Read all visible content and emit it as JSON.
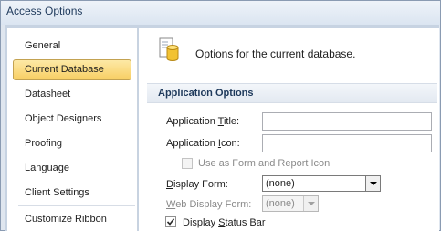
{
  "window": {
    "title": "Access Options"
  },
  "sidebar": {
    "items": [
      {
        "label": "General",
        "active": false
      },
      {
        "label": "Current Database",
        "active": true
      },
      {
        "label": "Datasheet",
        "active": false
      },
      {
        "label": "Object Designers",
        "active": false
      },
      {
        "label": "Proofing",
        "active": false
      },
      {
        "label": "Language",
        "active": false
      },
      {
        "label": "Client Settings",
        "active": false
      },
      {
        "label": "Customize Ribbon",
        "active": false
      }
    ]
  },
  "content": {
    "header": "Options for the current database.",
    "header_icon": "database-icon",
    "section_title": "Application Options",
    "app_title": {
      "label_pre": "Application ",
      "label_ul": "T",
      "label_post": "itle:",
      "value": ""
    },
    "app_icon": {
      "label_pre": "Application ",
      "label_ul": "I",
      "label_post": "con:",
      "value": ""
    },
    "form_report_icon": {
      "label": "Use as Form and Report Icon",
      "checked": false,
      "enabled": false
    },
    "display_form": {
      "label_ul": "D",
      "label_post": "isplay Form:",
      "value": "(none)"
    },
    "web_display_form": {
      "label_ul": "W",
      "label_post": "eb Display Form:",
      "value": "(none)",
      "enabled": false
    },
    "status_bar": {
      "label_pre": "Display ",
      "label_ul": "S",
      "label_post": "tatus Bar",
      "checked": true
    }
  },
  "colors": {
    "active_item": "#f8cf64",
    "section_title": "#1e395b",
    "window_border": "#8a9bb2"
  }
}
